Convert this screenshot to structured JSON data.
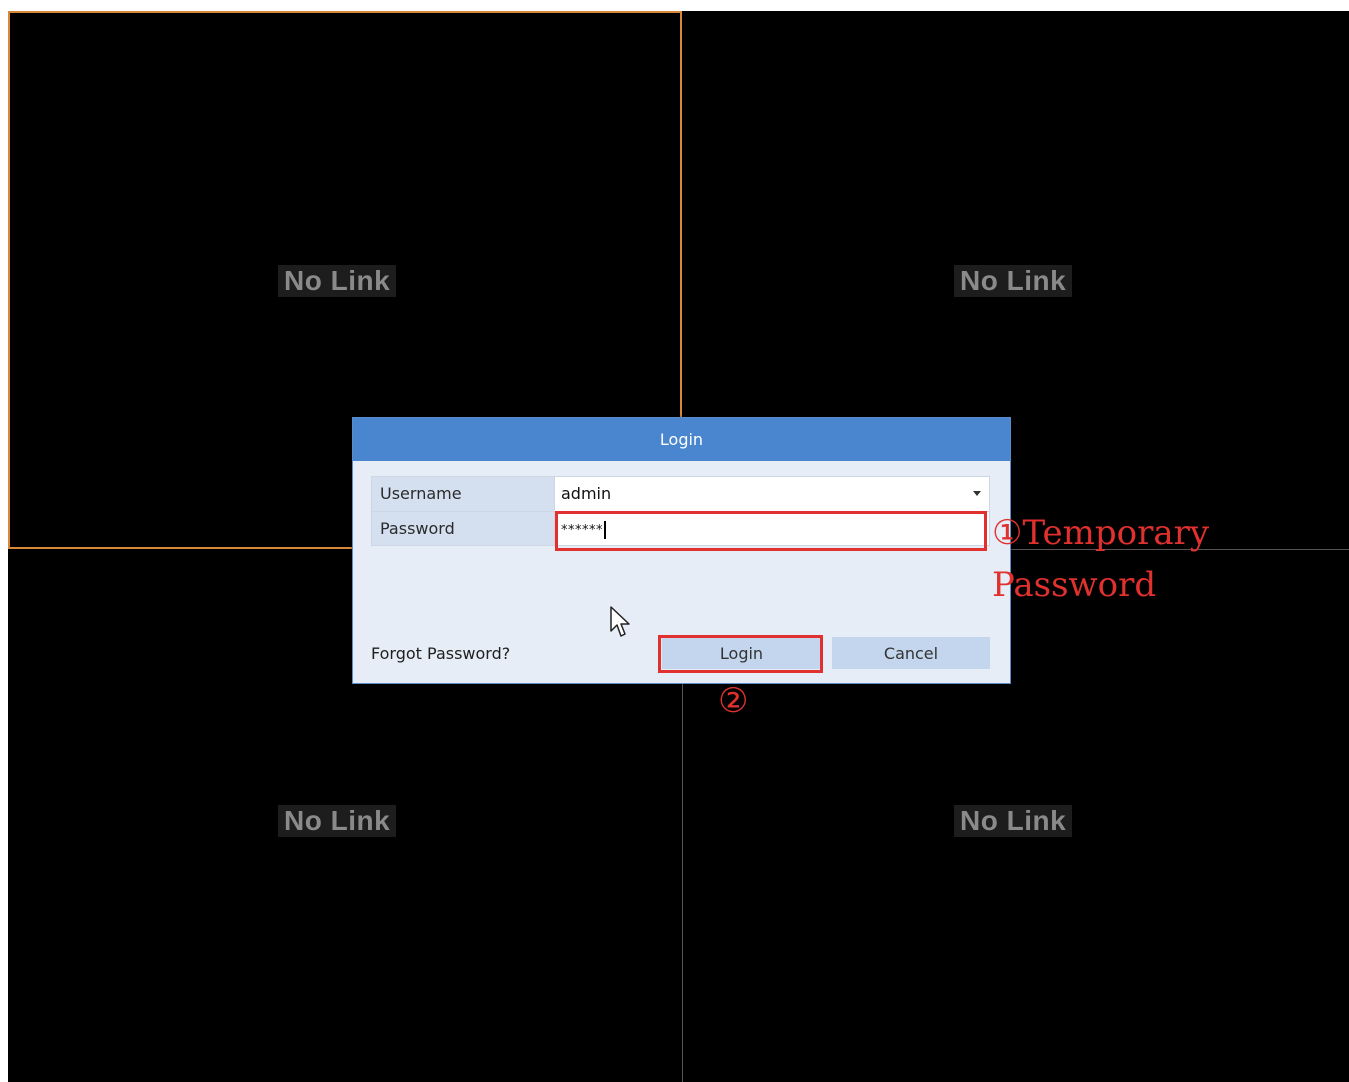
{
  "panes": [
    {
      "status": "No Link"
    },
    {
      "status": "No Link"
    },
    {
      "status": "No Link"
    },
    {
      "status": "No Link"
    }
  ],
  "dialog": {
    "title": "Login",
    "fields": {
      "username": {
        "label": "Username",
        "value": "admin"
      },
      "password": {
        "label": "Password",
        "value": "******"
      }
    },
    "forgot_label": "Forgot Password?",
    "login_label": "Login",
    "cancel_label": "Cancel"
  },
  "annotations": {
    "step1": "①Temporary\nPassword",
    "step2": "②"
  },
  "colors": {
    "selected_pane_border": "#d8883a",
    "dialog_title_bg": "#4a86cf",
    "annotation_red": "#e0312e"
  }
}
